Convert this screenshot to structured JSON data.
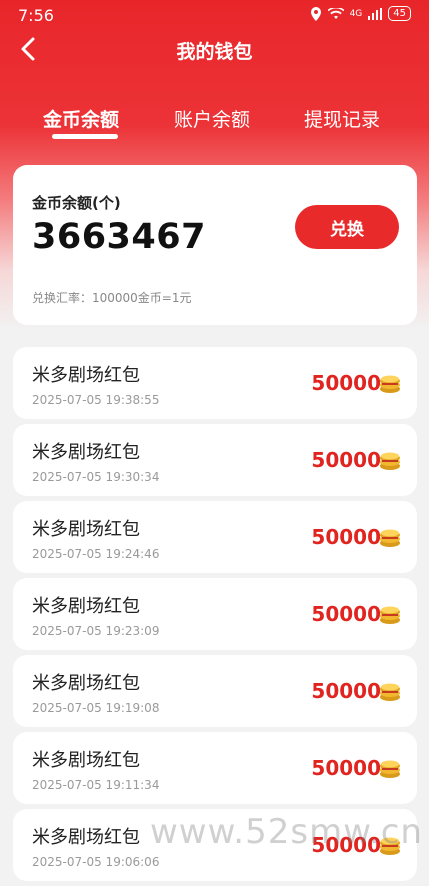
{
  "status_bar": {
    "time": "7:56",
    "battery": "45",
    "network": "4G"
  },
  "header": {
    "title": "我的钱包"
  },
  "tabs": [
    {
      "label": "金币余额",
      "active": true
    },
    {
      "label": "账户余额",
      "active": false
    },
    {
      "label": "提现记录",
      "active": false
    }
  ],
  "balance": {
    "label": "金币余额(个)",
    "value": "3663467",
    "exchange_label": "兑换",
    "rate_text": "兑换汇率：100000金币=1元"
  },
  "records": [
    {
      "title": "米多剧场红包",
      "time": "2025-07-05 19:38:55",
      "amount": "50000"
    },
    {
      "title": "米多剧场红包",
      "time": "2025-07-05 19:30:34",
      "amount": "50000"
    },
    {
      "title": "米多剧场红包",
      "time": "2025-07-05 19:24:46",
      "amount": "50000"
    },
    {
      "title": "米多剧场红包",
      "time": "2025-07-05 19:23:09",
      "amount": "50000"
    },
    {
      "title": "米多剧场红包",
      "time": "2025-07-05 19:19:08",
      "amount": "50000"
    },
    {
      "title": "米多剧场红包",
      "time": "2025-07-05 19:11:34",
      "amount": "50000"
    },
    {
      "title": "米多剧场红包",
      "time": "2025-07-05 19:06:06",
      "amount": "50000"
    }
  ],
  "watermark": "www.52smw.cn",
  "colors": {
    "primary": "#e82a2a",
    "amount": "#e0241f"
  }
}
